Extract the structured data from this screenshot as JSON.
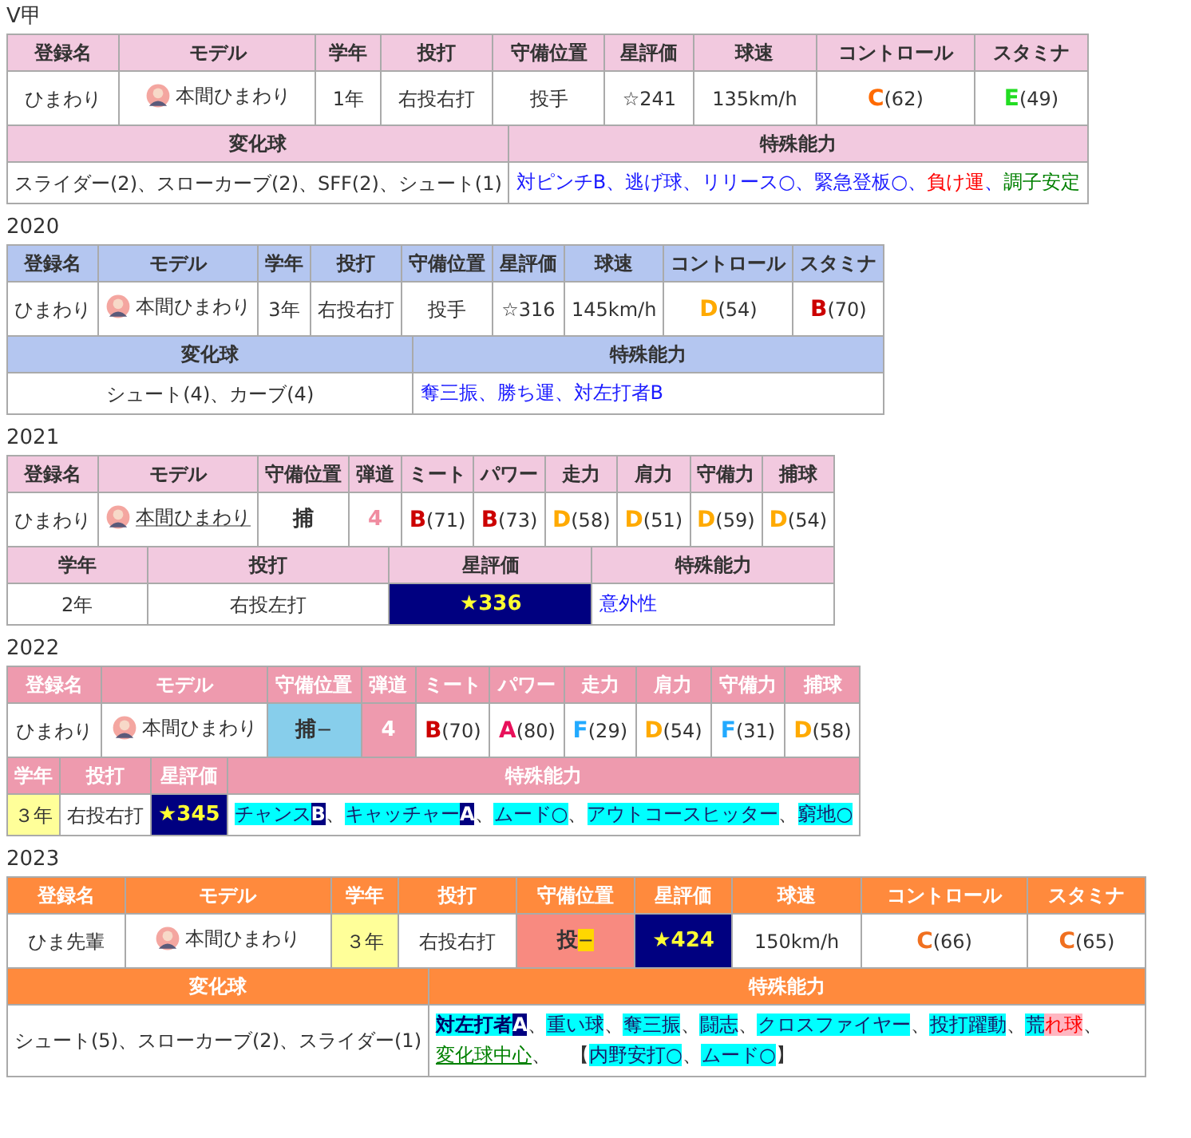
{
  "sections": [
    {
      "title": "V甲",
      "color": "#f2c9df",
      "top": {
        "headers": [
          "登録名",
          "モデル",
          "学年",
          "投打",
          "守備位置",
          "星評価",
          "球速",
          "コントロール",
          "スタミナ"
        ],
        "cells": [
          {
            "kind": "text",
            "text": "ひまわり"
          },
          {
            "kind": "model",
            "text": "本間ひまわり",
            "link": false
          },
          {
            "kind": "year",
            "text": "1年",
            "highlight": false
          },
          {
            "kind": "text",
            "text": "右投右打"
          },
          {
            "kind": "text",
            "text": "投手"
          },
          {
            "kind": "star",
            "text": "☆241",
            "highlight": false
          },
          {
            "kind": "text",
            "text": "135km/h"
          },
          {
            "kind": "grade",
            "grade": "C",
            "value": "(62)",
            "color": "#ff6a00"
          },
          {
            "kind": "grade",
            "grade": "E",
            "value": "(49)",
            "color": "#22dd22"
          }
        ]
      },
      "bottom": {
        "headers": [
          "変化球",
          "特殊能力"
        ],
        "cells": [
          {
            "kind": "text",
            "text": "スライダー(2)、スローカーブ(2)、SFF(2)、シュート(1)"
          },
          {
            "kind": "abilities",
            "segments": [
              {
                "kind": "text",
                "text": "対ピンチB、逃げ球、リリース○、緊急登板○、",
                "color": "#1a1aff"
              },
              {
                "kind": "text",
                "text": "負け運",
                "color": "#ff0000"
              },
              {
                "kind": "text",
                "text": "、",
                "color": "#1a1aff"
              },
              {
                "kind": "text",
                "text": "調子安定",
                "color": "#008000"
              }
            ]
          }
        ]
      }
    },
    {
      "title": "2020",
      "color": "#b4c6f0",
      "top": {
        "headers": [
          "登録名",
          "モデル",
          "学年",
          "投打",
          "守備位置",
          "星評価",
          "球速",
          "コントロール",
          "スタミナ"
        ],
        "cells": [
          {
            "kind": "text",
            "text": "ひまわり"
          },
          {
            "kind": "model",
            "text": "本間ひまわり",
            "link": false
          },
          {
            "kind": "year",
            "text": "3年",
            "highlight": false
          },
          {
            "kind": "text",
            "text": "右投右打"
          },
          {
            "kind": "text",
            "text": "投手"
          },
          {
            "kind": "star",
            "text": "☆316",
            "highlight": false
          },
          {
            "kind": "text",
            "text": "145km/h"
          },
          {
            "kind": "grade",
            "grade": "D",
            "value": "(54)",
            "color": "#ffaa00"
          },
          {
            "kind": "grade",
            "grade": "B",
            "value": "(70)",
            "color": "#cc0000"
          }
        ]
      },
      "bottom": {
        "headers": [
          "変化球",
          "特殊能力"
        ],
        "cells": [
          {
            "kind": "text",
            "text": "シュート(4)、カーブ(4)"
          },
          {
            "kind": "abilities",
            "segments": [
              {
                "kind": "text",
                "text": "奪三振、勝ち運、対左打者B",
                "color": "#1a1aff"
              }
            ]
          }
        ]
      }
    },
    {
      "title": "2021",
      "color": "#f2c9df",
      "top": {
        "headers": [
          "登録名",
          "モデル",
          "守備位置",
          "弾道",
          "ミート",
          "パワー",
          "走力",
          "肩力",
          "守備力",
          "捕球"
        ],
        "cells": [
          {
            "kind": "text",
            "text": "ひまわり"
          },
          {
            "kind": "model",
            "text": "本間ひまわり",
            "link": true
          },
          {
            "kind": "position",
            "text": "捕"
          },
          {
            "kind": "trajectory",
            "text": "4",
            "highlight": false
          },
          {
            "kind": "grade",
            "grade": "B",
            "value": "(71)",
            "color": "#cc0000"
          },
          {
            "kind": "grade",
            "grade": "B",
            "value": "(73)",
            "color": "#cc0000"
          },
          {
            "kind": "grade",
            "grade": "D",
            "value": "(58)",
            "color": "#ffaa00"
          },
          {
            "kind": "grade",
            "grade": "D",
            "value": "(51)",
            "color": "#ffaa00"
          },
          {
            "kind": "grade",
            "grade": "D",
            "value": "(59)",
            "color": "#ffaa00"
          },
          {
            "kind": "grade",
            "grade": "D",
            "value": "(54)",
            "color": "#ffaa00"
          }
        ]
      },
      "bottom": {
        "headers": [
          "学年",
          "投打",
          "星評価",
          "特殊能力"
        ],
        "cells": [
          {
            "kind": "year",
            "text": "2年",
            "highlight": false
          },
          {
            "kind": "text",
            "text": "右投左打"
          },
          {
            "kind": "star",
            "text": "★336",
            "highlight": true
          },
          {
            "kind": "abilities",
            "segments": [
              {
                "kind": "text",
                "text": "意外性",
                "color": "#1a1aff"
              }
            ]
          }
        ]
      }
    },
    {
      "title": "2022",
      "color": "#ee9aae",
      "top": {
        "headers": [
          "登録名",
          "モデル",
          "守備位置",
          "弾道",
          "ミート",
          "パワー",
          "走力",
          "肩力",
          "守備力",
          "捕球"
        ],
        "cells": [
          {
            "kind": "text",
            "text": "ひまわり"
          },
          {
            "kind": "model",
            "text": "本間ひまわり",
            "link": false
          },
          {
            "kind": "position",
            "text": "捕",
            "suffix": "−",
            "color": "#87ceeb",
            "suffix_marked": false
          },
          {
            "kind": "trajectory",
            "text": "4",
            "highlight": true
          },
          {
            "kind": "grade",
            "grade": "B",
            "value": "(70)",
            "color": "#cc0000"
          },
          {
            "kind": "grade",
            "grade": "A",
            "value": "(80)",
            "color": "#e8105a"
          },
          {
            "kind": "grade",
            "grade": "F",
            "value": "(29)",
            "color": "#22aaff"
          },
          {
            "kind": "grade",
            "grade": "D",
            "value": "(54)",
            "color": "#ffaa00"
          },
          {
            "kind": "grade",
            "grade": "F",
            "value": "(31)",
            "color": "#22aaff"
          },
          {
            "kind": "grade",
            "grade": "D",
            "value": "(58)",
            "color": "#ffaa00"
          }
        ]
      },
      "bottom": {
        "headers": [
          "学年",
          "投打",
          "星評価",
          "特殊能力"
        ],
        "cells": [
          {
            "kind": "year",
            "text": "３年",
            "highlight": true
          },
          {
            "kind": "text",
            "text": "右投右打"
          },
          {
            "kind": "star",
            "text": "★345",
            "highlight": true
          },
          {
            "kind": "abilities",
            "segments": [
              {
                "kind": "highlight",
                "text": "チャンス"
              },
              {
                "kind": "badge",
                "text": "B"
              },
              {
                "kind": "plain",
                "text": "、"
              },
              {
                "kind": "highlight",
                "text": "キャッチャー"
              },
              {
                "kind": "badge",
                "text": "A"
              },
              {
                "kind": "plain",
                "text": "、"
              },
              {
                "kind": "highlight",
                "text": "ムード○"
              },
              {
                "kind": "plain",
                "text": "、"
              },
              {
                "kind": "highlight",
                "text": "アウトコースヒッター"
              },
              {
                "kind": "plain",
                "text": "、"
              },
              {
                "kind": "highlight",
                "text": "窮地○"
              }
            ]
          }
        ]
      }
    },
    {
      "title": "2023",
      "color": "#ff8a3d",
      "top": {
        "headers": [
          "登録名",
          "モデル",
          "学年",
          "投打",
          "守備位置",
          "星評価",
          "球速",
          "コントロール",
          "スタミナ"
        ],
        "cells": [
          {
            "kind": "text",
            "text": "ひま先輩"
          },
          {
            "kind": "model",
            "text": "本間ひまわり",
            "link": false
          },
          {
            "kind": "year",
            "text": "３年",
            "highlight": true
          },
          {
            "kind": "text",
            "text": "右投右打"
          },
          {
            "kind": "position",
            "text": "投",
            "suffix": "−",
            "color": "#f88a80",
            "suffix_marked": true
          },
          {
            "kind": "star",
            "text": "★424",
            "highlight": true
          },
          {
            "kind": "text",
            "text": "150km/h"
          },
          {
            "kind": "grade",
            "grade": "C",
            "value": "(66)",
            "color": "#f07020"
          },
          {
            "kind": "grade",
            "grade": "C",
            "value": "(65)",
            "color": "#f07020"
          }
        ]
      },
      "bottom": {
        "headers": [
          "変化球",
          "特殊能力"
        ],
        "cells": [
          {
            "kind": "text",
            "text": "シュート(5)、スローカーブ(2)、スライダー(1)"
          },
          {
            "kind": "abilities",
            "segments": [
              {
                "kind": "highlight-bold",
                "text": "対左打者"
              },
              {
                "kind": "badge",
                "text": "A"
              },
              {
                "kind": "plain",
                "text": "、"
              },
              {
                "kind": "highlight",
                "text": "重い球"
              },
              {
                "kind": "plain",
                "text": "、"
              },
              {
                "kind": "highlight",
                "text": "奪三振"
              },
              {
                "kind": "plain",
                "text": "、"
              },
              {
                "kind": "highlight",
                "text": "闘志"
              },
              {
                "kind": "plain",
                "text": "、"
              },
              {
                "kind": "highlight",
                "text": "クロスファイヤー"
              },
              {
                "kind": "plain",
                "text": "、"
              },
              {
                "kind": "highlight",
                "text": "投打躍動"
              },
              {
                "kind": "plain",
                "text": "、"
              },
              {
                "kind": "highlight",
                "text": "荒"
              },
              {
                "kind": "warning",
                "text": "れ球"
              },
              {
                "kind": "plain",
                "text": "、"
              },
              {
                "kind": "link",
                "text": "変化球中心"
              },
              {
                "kind": "plain",
                "text": "、　【"
              },
              {
                "kind": "highlight",
                "text": "内野安打○"
              },
              {
                "kind": "plain",
                "text": "、"
              },
              {
                "kind": "highlight",
                "text": "ムード○"
              },
              {
                "kind": "plain",
                "text": "】"
              }
            ]
          }
        ]
      }
    }
  ]
}
